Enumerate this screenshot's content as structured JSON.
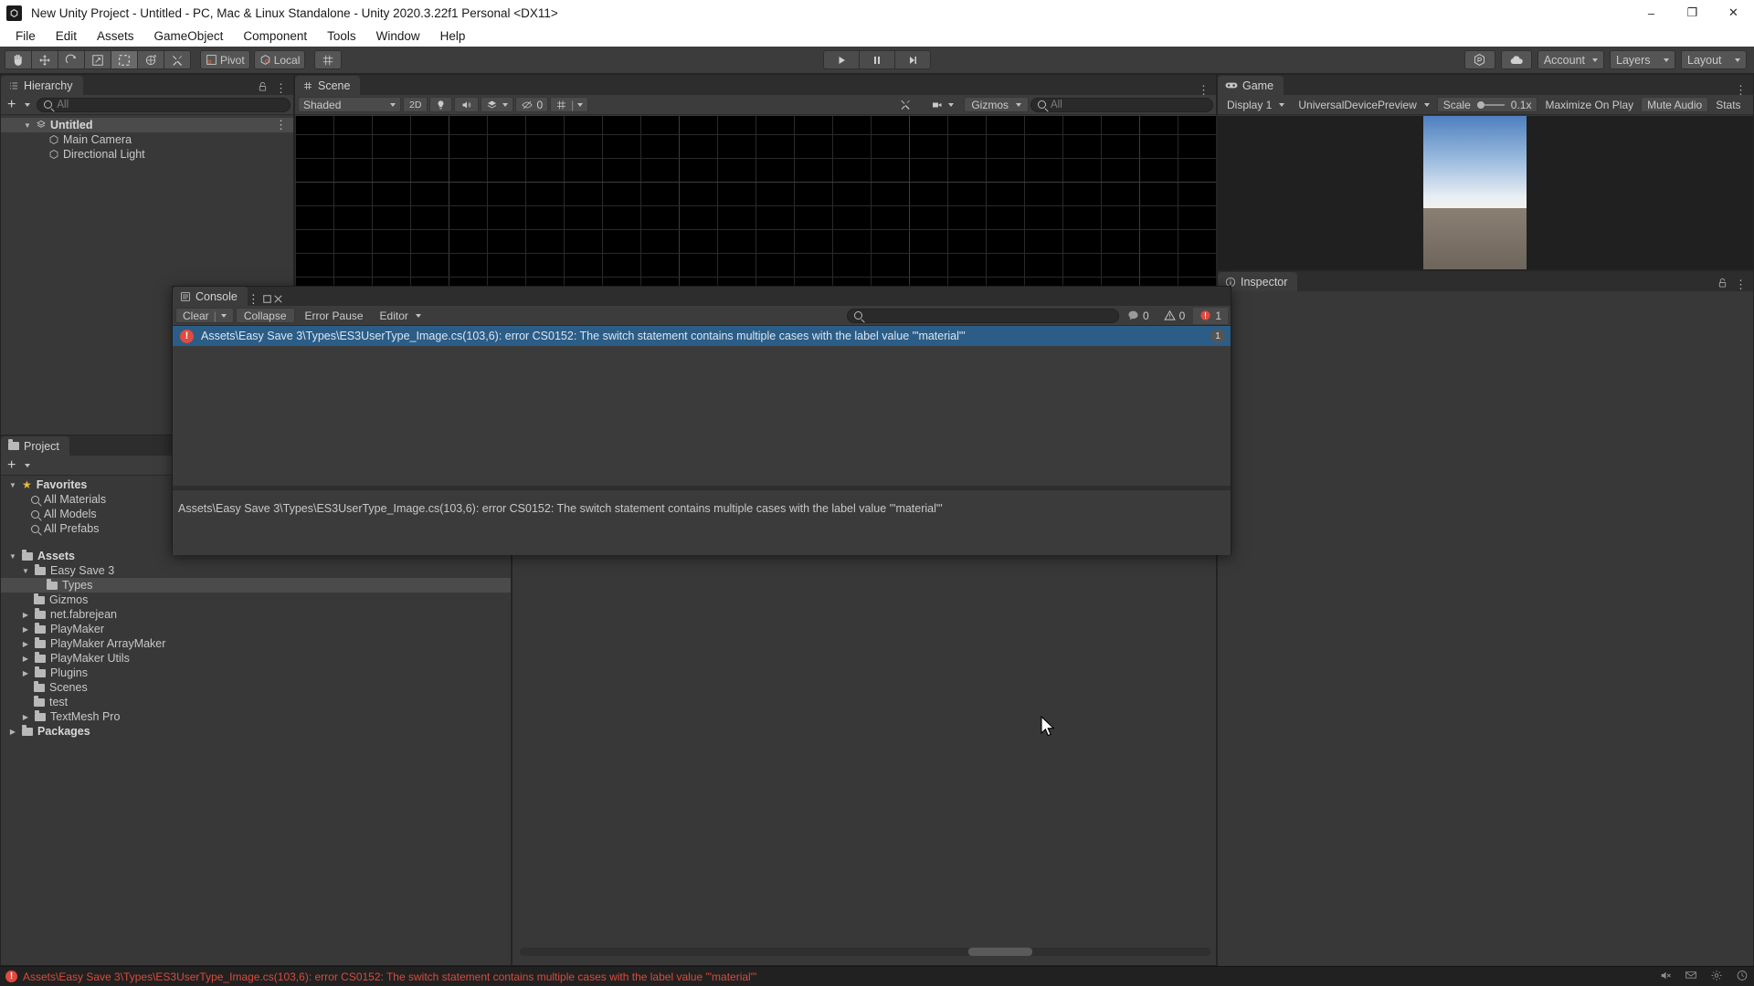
{
  "window": {
    "title": "New Unity Project - Untitled - PC, Mac & Linux Standalone - Unity 2020.3.22f1 Personal <DX11>",
    "minimize": "–",
    "maximize": "❐",
    "close": "✕"
  },
  "menubar": {
    "items": [
      "File",
      "Edit",
      "Assets",
      "GameObject",
      "Component",
      "Tools",
      "Window",
      "Help"
    ]
  },
  "toolbar": {
    "tools": [
      {
        "name": "hand-tool",
        "label": ""
      },
      {
        "name": "move-tool",
        "label": ""
      },
      {
        "name": "rotate-tool",
        "label": ""
      },
      {
        "name": "scale-tool",
        "label": ""
      },
      {
        "name": "rect-tool",
        "label": ""
      },
      {
        "name": "transform-tool",
        "label": ""
      },
      {
        "name": "custom-tool",
        "label": ""
      }
    ],
    "pivot_label": "Pivot",
    "local_label": "Local",
    "play_label": "▶",
    "pause_label": "❙❙",
    "step_label": "▶❙",
    "collab_label": "",
    "cloud_label": "",
    "account_label": "Account",
    "layers_label": "Layers",
    "layout_label": "Layout"
  },
  "hierarchy": {
    "tab_label": "Hierarchy",
    "add_label": "+",
    "search_placeholder": "All",
    "items": [
      {
        "label": "Untitled",
        "indent": 0,
        "selected": true,
        "icon": "scene-icon",
        "expanded": true
      },
      {
        "label": "Main Camera",
        "indent": 1,
        "selected": false,
        "icon": "gameobject-icon",
        "expanded": false
      },
      {
        "label": "Directional Light",
        "indent": 1,
        "selected": false,
        "icon": "gameobject-icon",
        "expanded": false
      }
    ]
  },
  "scene": {
    "tab_label": "Scene",
    "shading_mode": "Shaded",
    "mode_2d": "2D",
    "hidden_count": "0",
    "gizmos_label": "Gizmos",
    "search_placeholder": "All"
  },
  "game": {
    "tab_label": "Game",
    "display": "Display 1",
    "aspect": "UniversalDevicePreview",
    "scale_label": "Scale",
    "scale_value": "0.1x",
    "maximize_on_play": "Maximize On Play",
    "mute_audio": "Mute Audio",
    "stats": "Stats"
  },
  "inspector": {
    "tab_label": "Inspector"
  },
  "project": {
    "tab_label": "Project",
    "add_label": "+",
    "tree": [
      {
        "label": "Favorites",
        "indent": 0,
        "icon": "star-icon",
        "arrow": "down",
        "bold": true,
        "selected": false
      },
      {
        "label": "All Materials",
        "indent": 1,
        "icon": "search-icon",
        "arrow": "none",
        "bold": false,
        "selected": false
      },
      {
        "label": "All Models",
        "indent": 1,
        "icon": "search-icon",
        "arrow": "none",
        "bold": false,
        "selected": false
      },
      {
        "label": "All Prefabs",
        "indent": 1,
        "icon": "search-icon",
        "arrow": "none",
        "bold": false,
        "selected": false
      },
      {
        "label": "",
        "indent": 0,
        "icon": "none",
        "arrow": "none",
        "bold": false,
        "selected": false
      },
      {
        "label": "Assets",
        "indent": 0,
        "icon": "folder-icon",
        "arrow": "down",
        "bold": true,
        "selected": false
      },
      {
        "label": "Easy Save 3",
        "indent": 1,
        "icon": "folder-icon",
        "arrow": "down",
        "bold": false,
        "selected": false
      },
      {
        "label": "Types",
        "indent": 2,
        "icon": "folder-icon",
        "arrow": "none",
        "bold": false,
        "selected": true
      },
      {
        "label": "Gizmos",
        "indent": 1,
        "icon": "folder-icon",
        "arrow": "none",
        "bold": false,
        "selected": false
      },
      {
        "label": "net.fabrejean",
        "indent": 1,
        "icon": "folder-icon",
        "arrow": "right",
        "bold": false,
        "selected": false
      },
      {
        "label": "PlayMaker",
        "indent": 1,
        "icon": "folder-icon",
        "arrow": "right",
        "bold": false,
        "selected": false
      },
      {
        "label": "PlayMaker ArrayMaker",
        "indent": 1,
        "icon": "folder-icon",
        "arrow": "right",
        "bold": false,
        "selected": false
      },
      {
        "label": "PlayMaker Utils",
        "indent": 1,
        "icon": "folder-icon",
        "arrow": "right",
        "bold": false,
        "selected": false
      },
      {
        "label": "Plugins",
        "indent": 1,
        "icon": "folder-icon",
        "arrow": "right",
        "bold": false,
        "selected": false
      },
      {
        "label": "Scenes",
        "indent": 1,
        "icon": "folder-icon",
        "arrow": "none",
        "bold": false,
        "selected": false
      },
      {
        "label": "test",
        "indent": 1,
        "icon": "folder-icon",
        "arrow": "none",
        "bold": false,
        "selected": false
      },
      {
        "label": "TextMesh Pro",
        "indent": 1,
        "icon": "folder-icon",
        "arrow": "right",
        "bold": false,
        "selected": false
      },
      {
        "label": "Packages",
        "indent": 0,
        "icon": "folder-icon",
        "arrow": "right",
        "bold": true,
        "selected": false
      }
    ]
  },
  "console": {
    "tab_label": "Console",
    "clear_label": "Clear",
    "collapse_label": "Collapse",
    "error_pause_label": "Error Pause",
    "editor_label": "Editor",
    "search_placeholder": "",
    "counts": {
      "info": "0",
      "warning": "0",
      "error": "1"
    },
    "entries": [
      {
        "text": "Assets\\Easy Save 3\\Types\\ES3UserType_Image.cs(103,6): error CS0152: The switch statement contains multiple cases with the label value '\"material\"'",
        "badge": "1",
        "type": "error",
        "selected": true
      }
    ],
    "detail": "Assets\\Easy Save 3\\Types\\ES3UserType_Image.cs(103,6): error CS0152: The switch statement contains multiple cases with the label value '\"material\"'"
  },
  "statusbar": {
    "message": "Assets\\Easy Save 3\\Types\\ES3UserType_Image.cs(103,6): error CS0152: The switch statement contains multiple cases with the label value '\"material\"'"
  },
  "colors": {
    "error": "#d84b3c",
    "selection": "#2c5d87",
    "panel": "#383838",
    "toolbar": "#3c3c3c"
  }
}
